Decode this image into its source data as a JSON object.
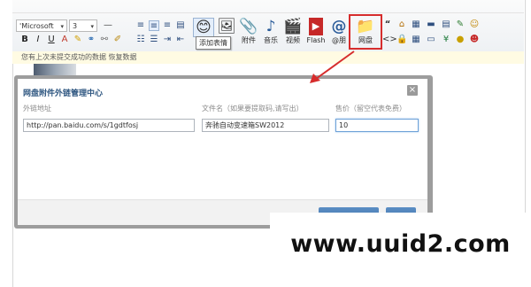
{
  "toolbar": {
    "font_family": "'Microsoft",
    "font_size": "3",
    "font_color": "",
    "big_buttons": [
      {
        "name": "emoji",
        "label": "",
        "glyph": "😊"
      },
      {
        "name": "image",
        "label": "",
        "glyph": "🖼"
      },
      {
        "name": "attachment",
        "label": "附件",
        "glyph": "📎"
      },
      {
        "name": "music",
        "label": "音乐",
        "glyph": "♪"
      },
      {
        "name": "video",
        "label": "视频",
        "glyph": "🎬"
      },
      {
        "name": "flash",
        "label": "Flash",
        "glyph": "▶"
      },
      {
        "name": "mention",
        "label": "@朋",
        "glyph": "@"
      },
      {
        "name": "netdisk",
        "label": "网盘",
        "glyph": "📁"
      }
    ],
    "tooltip": "添加表情"
  },
  "notice": {
    "text": "您有上次未提交成功的数据 恢复数据"
  },
  "dialog": {
    "title": "网盘附件外链管理中心",
    "close_glyph": "×",
    "fields": {
      "url_label": "外链地址",
      "url_value": "http://pan.baidu.com/s/1gdtfosj",
      "filename_label": "文件名（如果要提取码,请写出）",
      "filename_value": "奔驰自动变速箱SW2012",
      "price_label": "售价（留空代表免费）",
      "price_value": "10"
    }
  },
  "watermark": {
    "text": "www.uuid2.com"
  },
  "colors": {
    "highlight": "#d62d2d",
    "dialog_title": "#2e5680",
    "active_border": "#6fa2d8"
  }
}
